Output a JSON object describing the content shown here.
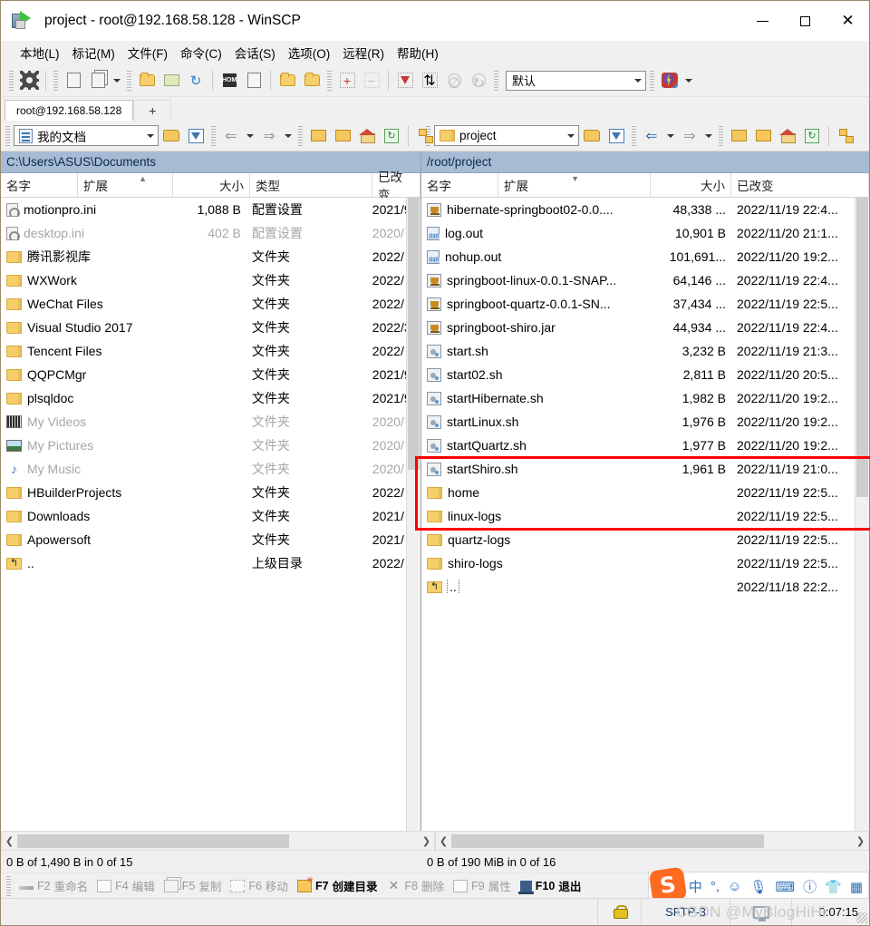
{
  "window": {
    "title": "project - root@192.168.58.128 - WinSCP",
    "app_icon": "winscp-icon",
    "minimize": "—",
    "maximize": "□",
    "close": "✕"
  },
  "menu": [
    {
      "label": "本地(L)",
      "name": "menu-local"
    },
    {
      "label": "标记(M)",
      "name": "menu-mark"
    },
    {
      "label": "文件(F)",
      "name": "menu-file"
    },
    {
      "label": "命令(C)",
      "name": "menu-command"
    },
    {
      "label": "会话(S)",
      "name": "menu-session"
    },
    {
      "label": "选项(O)",
      "name": "menu-options"
    },
    {
      "label": "远程(R)",
      "name": "menu-remote"
    },
    {
      "label": "帮助(H)",
      "name": "menu-help"
    }
  ],
  "toolbar": {
    "transfer_preset": "默认",
    "buttons": [
      "gear-icon",
      "address-book-icon",
      "copy-icon",
      "dropdown-caret-icon",
      "synchronize-icon",
      "synchronize-browsing-icon",
      "refresh-icon",
      "console-icon",
      "terminal-icon",
      "queue-icon",
      "find-icon",
      "add-icon",
      "remove-icon",
      "filter-icon",
      "refresh-queue-icon",
      "stop-icon",
      "reload-icon",
      "keep-remote-icon"
    ]
  },
  "session_tabs": {
    "active_tab": "root@192.168.58.128",
    "add_tab": "+"
  },
  "left_pane": {
    "address_value": "我的文档",
    "path": "C:\\Users\\ASUS\\Documents",
    "columns": [
      {
        "label": "名字",
        "name": "col-name"
      },
      {
        "label": "扩展",
        "name": "col-ext"
      },
      {
        "label": "大小",
        "name": "col-size"
      },
      {
        "label": "类型",
        "name": "col-type"
      },
      {
        "label": "已改变",
        "name": "col-changed"
      }
    ],
    "rows": [
      {
        "icon": "up-folder-icon",
        "name": "..",
        "size": "",
        "type": "上级目录",
        "changed": "2022/",
        "dim": false
      },
      {
        "icon": "folder-icon",
        "name": "Apowersoft",
        "size": "",
        "type": "文件夹",
        "changed": "2021/",
        "dim": false
      },
      {
        "icon": "folder-icon",
        "name": "Downloads",
        "size": "",
        "type": "文件夹",
        "changed": "2021/",
        "dim": false
      },
      {
        "icon": "folder-icon",
        "name": "HBuilderProjects",
        "size": "",
        "type": "文件夹",
        "changed": "2022/",
        "dim": false
      },
      {
        "icon": "music-icon",
        "name": "My Music",
        "size": "",
        "type": "文件夹",
        "changed": "2020/",
        "dim": true
      },
      {
        "icon": "picture-icon",
        "name": "My Pictures",
        "size": "",
        "type": "文件夹",
        "changed": "2020/",
        "dim": true
      },
      {
        "icon": "video-icon",
        "name": "My Videos",
        "size": "",
        "type": "文件夹",
        "changed": "2020/",
        "dim": true
      },
      {
        "icon": "folder-icon",
        "name": "plsqldoc",
        "size": "",
        "type": "文件夹",
        "changed": "2021/9",
        "dim": false
      },
      {
        "icon": "folder-icon",
        "name": "QQPCMgr",
        "size": "",
        "type": "文件夹",
        "changed": "2021/9",
        "dim": false
      },
      {
        "icon": "folder-icon",
        "name": "Tencent Files",
        "size": "",
        "type": "文件夹",
        "changed": "2022/",
        "dim": false
      },
      {
        "icon": "folder-icon",
        "name": "Visual Studio 2017",
        "size": "",
        "type": "文件夹",
        "changed": "2022/3",
        "dim": false
      },
      {
        "icon": "folder-icon",
        "name": "WeChat Files",
        "size": "",
        "type": "文件夹",
        "changed": "2022/",
        "dim": false
      },
      {
        "icon": "folder-icon",
        "name": "WXWork",
        "size": "",
        "type": "文件夹",
        "changed": "2022/",
        "dim": false
      },
      {
        "icon": "folder-icon",
        "name": "腾讯影视库",
        "size": "",
        "type": "文件夹",
        "changed": "2022/",
        "dim": false
      },
      {
        "icon": "ini-icon",
        "name": "desktop.ini",
        "size": "402 B",
        "type": "配置设置",
        "changed": "2020/",
        "dim": true
      },
      {
        "icon": "ini-icon",
        "name": "motionpro.ini",
        "size": "1,088 B",
        "type": "配置设置",
        "changed": "2021/9",
        "dim": false
      }
    ],
    "status": "0 B of 1,490 B in 0 of 15"
  },
  "right_pane": {
    "address_value": "project",
    "path": "/root/project",
    "columns": [
      {
        "label": "名字",
        "name": "col-name"
      },
      {
        "label": "扩展",
        "name": "col-ext"
      },
      {
        "label": "大小",
        "name": "col-size"
      },
      {
        "label": "已改变",
        "name": "col-changed"
      }
    ],
    "rows": [
      {
        "icon": "up-folder-icon",
        "name": "..",
        "size": "",
        "changed": "2022/11/18 22:2...",
        "highlight": false,
        "focused": true
      },
      {
        "icon": "folder-icon",
        "name": "shiro-logs",
        "size": "",
        "changed": "2022/11/19 22:5...",
        "highlight": false
      },
      {
        "icon": "folder-icon",
        "name": "quartz-logs",
        "size": "",
        "changed": "2022/11/19 22:5...",
        "highlight": false
      },
      {
        "icon": "folder-icon",
        "name": "linux-logs",
        "size": "",
        "changed": "2022/11/19 22:5...",
        "highlight": false
      },
      {
        "icon": "folder-icon",
        "name": "home",
        "size": "",
        "changed": "2022/11/19 22:5...",
        "highlight": false
      },
      {
        "icon": "shell-icon",
        "name": "startShiro.sh",
        "size": "1,961 B",
        "changed": "2022/11/19 21:0...",
        "highlight": false
      },
      {
        "icon": "shell-icon",
        "name": "startQuartz.sh",
        "size": "1,977 B",
        "changed": "2022/11/20 19:2...",
        "highlight": false
      },
      {
        "icon": "shell-icon",
        "name": "startLinux.sh",
        "size": "1,976 B",
        "changed": "2022/11/20 19:2...",
        "highlight": false
      },
      {
        "icon": "shell-icon",
        "name": "startHibernate.sh",
        "size": "1,982 B",
        "changed": "2022/11/20 19:2...",
        "highlight": false
      },
      {
        "icon": "shell-icon",
        "name": "start02.sh",
        "size": "2,811 B",
        "changed": "2022/11/20 20:5...",
        "highlight": false
      },
      {
        "icon": "shell-icon",
        "name": "start.sh",
        "size": "3,232 B",
        "changed": "2022/11/19 21:3...",
        "highlight": false
      },
      {
        "icon": "jar-icon",
        "name": "springboot-shiro.jar",
        "size": "44,934 ...",
        "changed": "2022/11/19 22:4...",
        "highlight": true
      },
      {
        "icon": "jar-icon",
        "name": "springboot-quartz-0.0.1-SN...",
        "size": "37,434 ...",
        "changed": "2022/11/19 22:5...",
        "highlight": true
      },
      {
        "icon": "jar-icon",
        "name": "springboot-linux-0.0.1-SNAP...",
        "size": "64,146 ...",
        "changed": "2022/11/19 22:4...",
        "highlight": true
      },
      {
        "icon": "out-icon",
        "name": "nohup.out",
        "size": "101,691...",
        "changed": "2022/11/20 19:2...",
        "highlight": false
      },
      {
        "icon": "out-icon",
        "name": "log.out",
        "size": "10,901 B",
        "changed": "2022/11/20 21:1...",
        "highlight": false
      },
      {
        "icon": "jar-icon",
        "name": "hibernate-springboot02-0.0....",
        "size": "48,338 ...",
        "changed": "2022/11/19 22:4...",
        "highlight": false
      }
    ],
    "status": "0 B of 190 MiB in 0 of 16"
  },
  "function_keys": [
    {
      "key": "F2",
      "label": "重命名",
      "icon": "rename-icon",
      "enabled": false
    },
    {
      "key": "F4",
      "label": "编辑",
      "icon": "edit-icon",
      "enabled": false
    },
    {
      "key": "F5",
      "label": "复制",
      "icon": "copy-icon",
      "enabled": false
    },
    {
      "key": "F6",
      "label": "移动",
      "icon": "move-icon",
      "enabled": false
    },
    {
      "key": "F7",
      "label": "创建目录",
      "icon": "new-folder-icon",
      "enabled": true
    },
    {
      "key": "F8",
      "label": "删除",
      "icon": "delete-icon",
      "enabled": false
    },
    {
      "key": "F9",
      "label": "属性",
      "icon": "properties-icon",
      "enabled": false
    },
    {
      "key": "F10",
      "label": "退出",
      "icon": "exit-icon",
      "enabled": true
    }
  ],
  "ime_tray": {
    "logo": "S",
    "items": [
      {
        "glyph": "中",
        "name": "ime-mode-chinese"
      },
      {
        "glyph": "°,",
        "name": "ime-punctuation"
      },
      {
        "glyph": "☺",
        "name": "ime-emoji"
      },
      {
        "glyph": "🎙",
        "name": "ime-voice"
      },
      {
        "glyph": "⌨",
        "name": "ime-keyboard"
      },
      {
        "glyph": "ⓘ",
        "name": "ime-toolbox"
      },
      {
        "glyph": "👕",
        "name": "ime-skin"
      },
      {
        "glyph": "▦",
        "name": "ime-menu"
      }
    ]
  },
  "bottom_bar": {
    "lock_icon": "lock-icon",
    "protocol": "SFTP-3",
    "monitor_icon": "monitor-icon",
    "elapsed": "0:07:15",
    "watermark": "CSDN @MyBlogHiHi"
  }
}
